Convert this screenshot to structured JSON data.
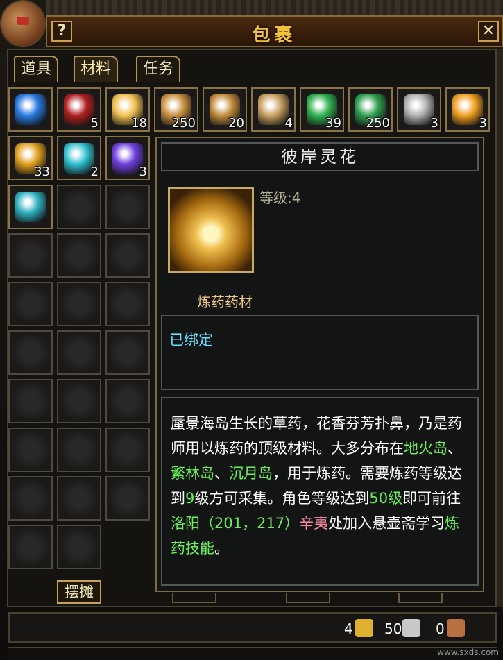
{
  "window": {
    "title": "包裹",
    "help_label": "?",
    "close_label": "✕"
  },
  "tabs": [
    {
      "label": "道具"
    },
    {
      "label": "材料"
    },
    {
      "label": "任务"
    }
  ],
  "slots": [
    {
      "color": "#2a7ae0",
      "qty": ""
    },
    {
      "color": "#b02020",
      "qty": "5"
    },
    {
      "color": "#f0c050",
      "qty": "18"
    },
    {
      "color": "#c89040",
      "qty": "250"
    },
    {
      "color": "#c08a3a",
      "qty": "20"
    },
    {
      "color": "#c8a060",
      "qty": "4"
    },
    {
      "color": "#30b050",
      "qty": "39"
    },
    {
      "color": "#30a050",
      "qty": "250"
    },
    {
      "color": "#b0b0b0",
      "qty": "3"
    },
    {
      "color": "#f0a020",
      "qty": "3"
    },
    {
      "color": "#e0a020",
      "qty": "33"
    },
    {
      "color": "#30c0d0",
      "qty": "2"
    },
    {
      "color": "#7040e0",
      "qty": "3"
    },
    {
      "color": "#30b0c0",
      "qty": ""
    }
  ],
  "tooltip": {
    "name": "彼岸灵花",
    "level": "等级:4",
    "type": "炼药药材",
    "bind": "已绑定",
    "desc": {
      "p1": "蜃景海岛生长的草药，花香芬芳扑鼻，乃是药师用以炼药的顶级材料。大多分布在",
      "loc1": "地火岛",
      "sep1": "、",
      "loc2": "繁林岛",
      "sep2": "、",
      "loc3": "沉月岛",
      "p2": "，用于炼药。需要炼药等级达到",
      "lvl": "9",
      "p3": "级方可采集。角色等级达到",
      "lvl2": "50级",
      "p4": "即可前往",
      "city": "洛阳（201，217）",
      "npc": "辛夷",
      "p5": "处加入悬壶斋学习",
      "skill": "炼药技能",
      "p6": "。"
    }
  },
  "buttons": {
    "stall": "摆摊"
  },
  "money": {
    "gold": "4",
    "silver": "50",
    "copper": "0"
  },
  "watermark": "www.sxds.com"
}
